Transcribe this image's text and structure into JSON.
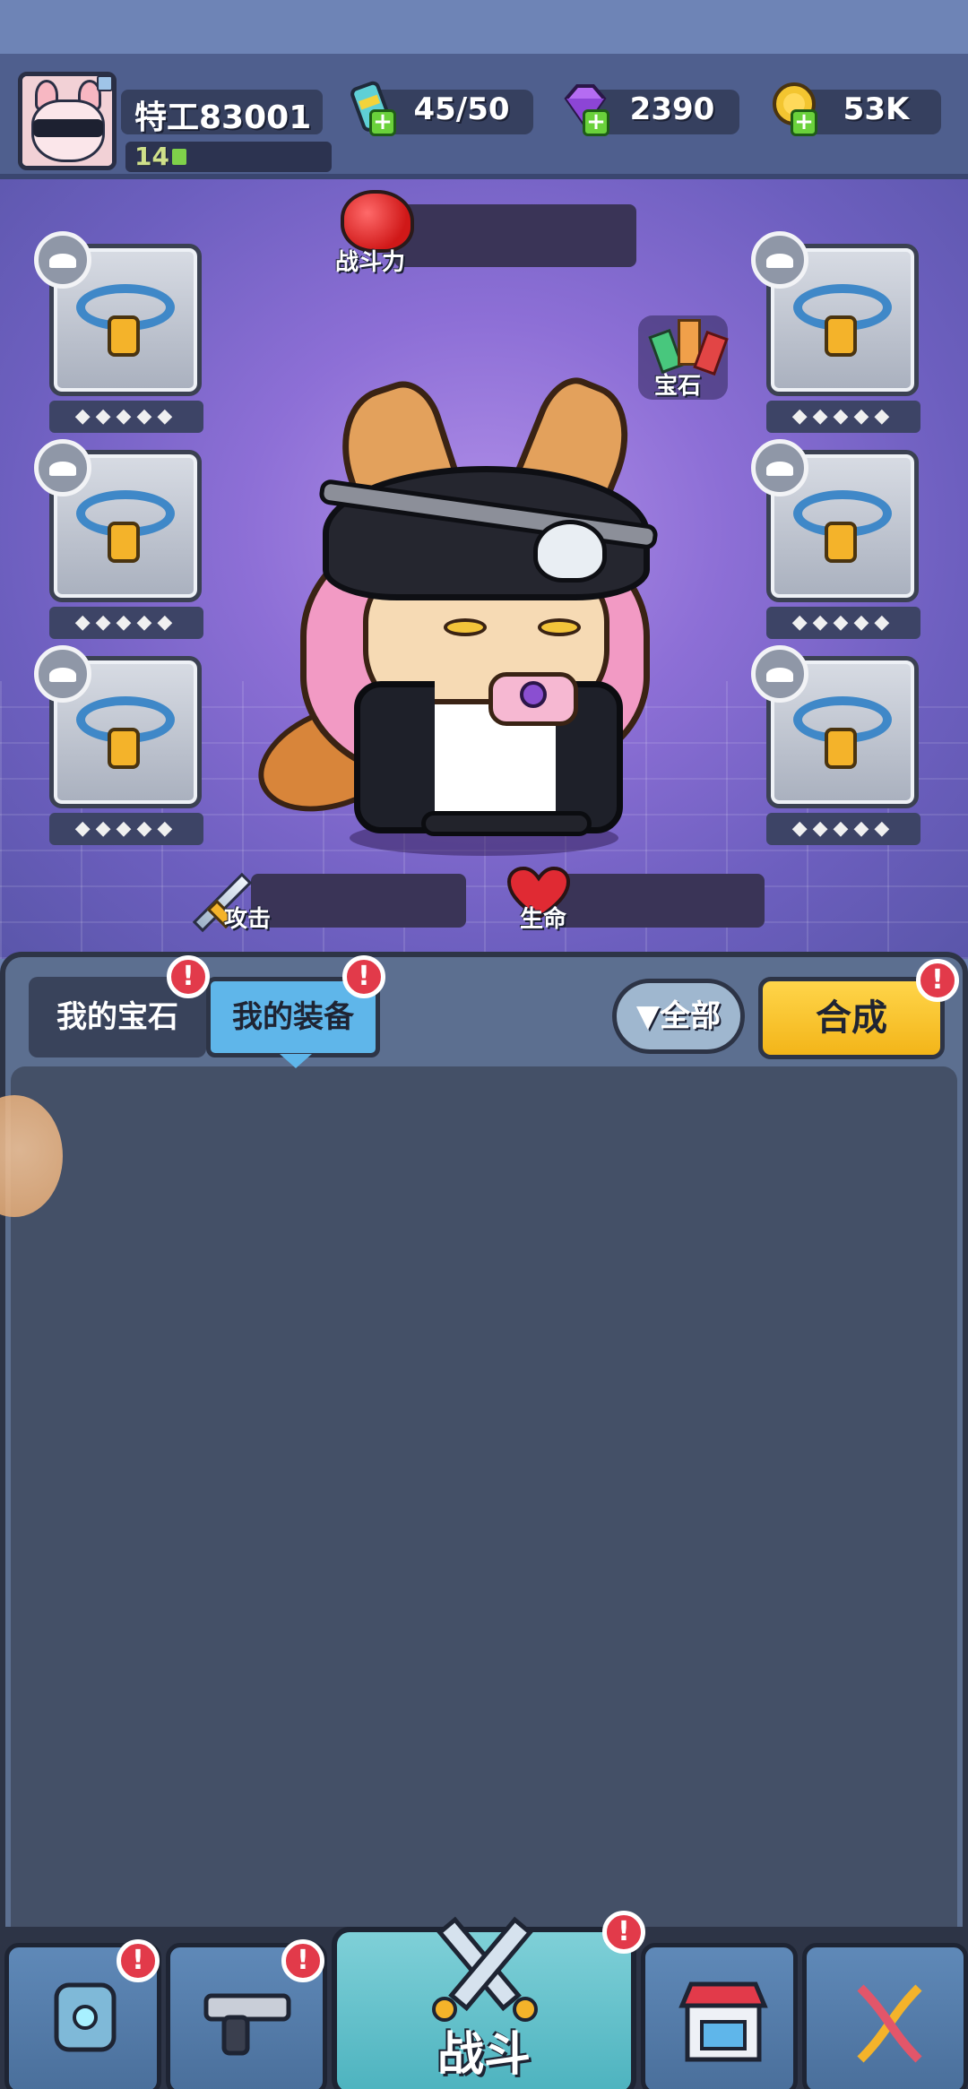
{
  "header": {
    "player_name": "特工83001",
    "level": "14",
    "resources": {
      "energy": "45/50",
      "gems": "2390",
      "coins": "53K"
    }
  },
  "stage": {
    "power_label": "战斗力",
    "gem_label": "宝石",
    "attack_label": "攻击",
    "hp_label": "生命",
    "slot_stars": "◆◆◆◆◆"
  },
  "panel": {
    "tab_gems": "我的宝石",
    "tab_equipment": "我的装备",
    "filter_label": "全部",
    "merge_label": "合成",
    "alert_mark": "!"
  },
  "nav": {
    "battle_label": "战斗"
  },
  "colors": {
    "accent": "#5fb6ea",
    "merge": "#f3b519",
    "alert": "#e23a4a"
  }
}
